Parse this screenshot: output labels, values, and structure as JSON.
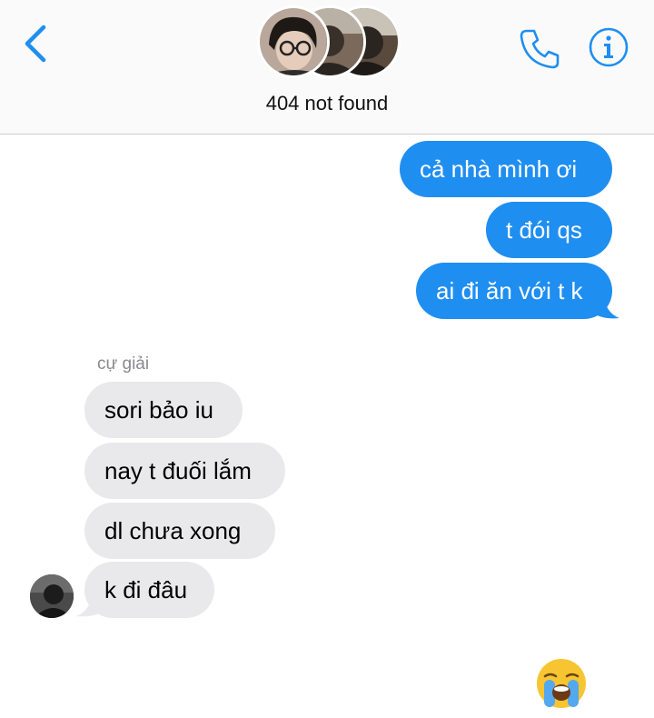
{
  "header": {
    "group_name": "404 not found",
    "back_icon": "chevron-left-icon",
    "call_icon": "phone-icon",
    "info_icon": "info-icon",
    "accent_color": "#1f8ef1"
  },
  "messages": {
    "outgoing": [
      {
        "text": "cả nhà mình ơi"
      },
      {
        "text": "t đói qs"
      },
      {
        "text": "ai đi ăn với t k"
      }
    ],
    "sender_name": "cự giải",
    "incoming": [
      {
        "text": "sori bảo iu"
      },
      {
        "text": "nay t đuối lắm"
      },
      {
        "text": "dl chưa xong"
      },
      {
        "text": "k đi đâu"
      }
    ]
  },
  "reaction": {
    "emoji": "loudly-crying-face-icon"
  },
  "colors": {
    "outgoing_bubble": "#1f8ef1",
    "incoming_bubble": "#e9e9eb"
  }
}
